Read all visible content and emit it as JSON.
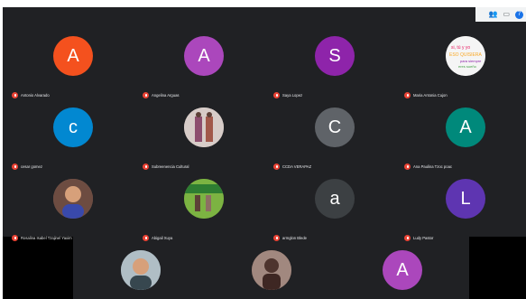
{
  "toolbar": {
    "people_icon": "people-icon",
    "chat_icon": "chat-icon",
    "badge": "7"
  },
  "participants": [
    {
      "name": "Antonio Alvarado",
      "initial": "A",
      "color": "#f4511e",
      "type": "letter"
    },
    {
      "name": "Angelina Arguas",
      "initial": "A",
      "color": "#ab47bc",
      "type": "letter"
    },
    {
      "name": "Saya Lopez",
      "initial": "S",
      "color": "#8e24aa",
      "type": "letter"
    },
    {
      "name": "Maria Antonia Cujon",
      "initial": "",
      "color": "#ffffff",
      "type": "image"
    },
    {
      "name": "cesar gomez",
      "initial": "c",
      "color": "#0288d1",
      "type": "letter"
    },
    {
      "name": "Subreenencia Cultural",
      "initial": "",
      "color": "#6d4c41",
      "type": "image"
    },
    {
      "name": "CCDA VERAPAZ",
      "initial": "C",
      "color": "#5f6368",
      "type": "letter"
    },
    {
      "name": "Ana Paulina Tzoc poac",
      "initial": "A",
      "color": "#00897b",
      "type": "letter"
    },
    {
      "name": "Rosalina Isabel Tzajinel Yaxim",
      "initial": "",
      "color": "#8d6e63",
      "type": "image"
    },
    {
      "name": "Abigail Xuya",
      "initial": "",
      "color": "#558b2f",
      "type": "image"
    },
    {
      "name": "armglon Blede",
      "initial": "a",
      "color": "#3c4043",
      "type": "letter"
    },
    {
      "name": "Ludy Pastor",
      "initial": "L",
      "color": "#5e35b1",
      "type": "letter"
    },
    {
      "name": "",
      "initial": "",
      "color": "#90a4ae",
      "type": "image"
    },
    {
      "name": "",
      "initial": "",
      "color": "#795548",
      "type": "image"
    },
    {
      "name": "",
      "initial": "A",
      "color": "#ab47bc",
      "type": "letter"
    }
  ]
}
